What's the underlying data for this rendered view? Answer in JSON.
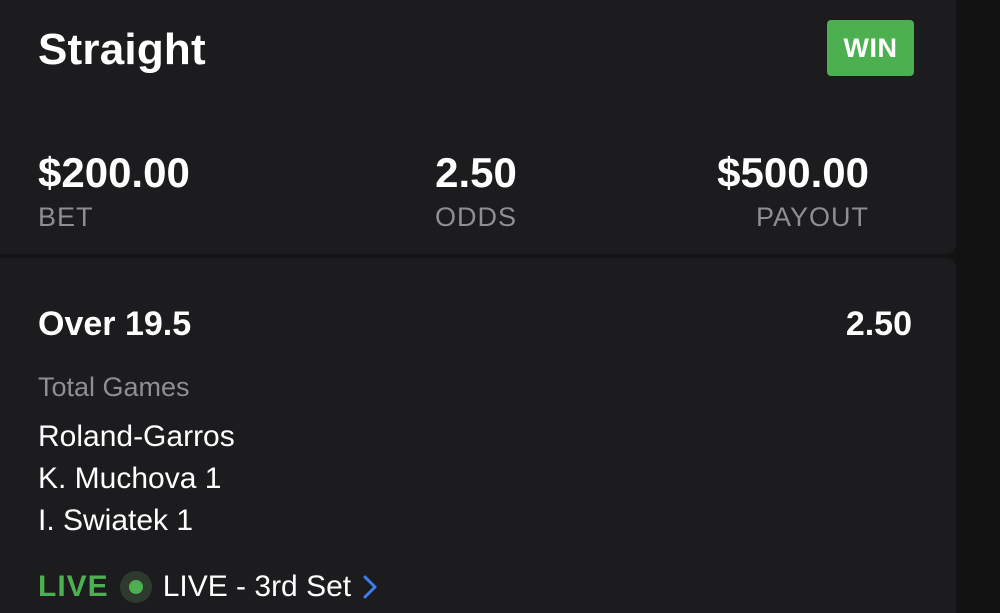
{
  "header": {
    "bet_type": "Straight",
    "result_badge": "WIN"
  },
  "summary": {
    "bet_amount": "$200.00",
    "bet_label": "BET",
    "odds": "2.50",
    "odds_label": "ODDS",
    "payout": "$500.00",
    "payout_label": "PAYOUT"
  },
  "leg": {
    "selection": "Over 19.5",
    "odds": "2.50",
    "market": "Total Games",
    "tournament": "Roland-Garros",
    "player1": "K. Muchova 1",
    "player2": "I. Swiatek 1",
    "live_tag": "LIVE",
    "live_status": "LIVE - 3rd Set"
  },
  "icons": {
    "live_indicator": "live-dot-icon",
    "details_link": "chevron-right-icon"
  },
  "colors": {
    "win_green": "#4caf50",
    "chevron_blue": "#3d7ef0",
    "card_background": "#1c1c1e",
    "muted_text": "#8e8e93"
  }
}
